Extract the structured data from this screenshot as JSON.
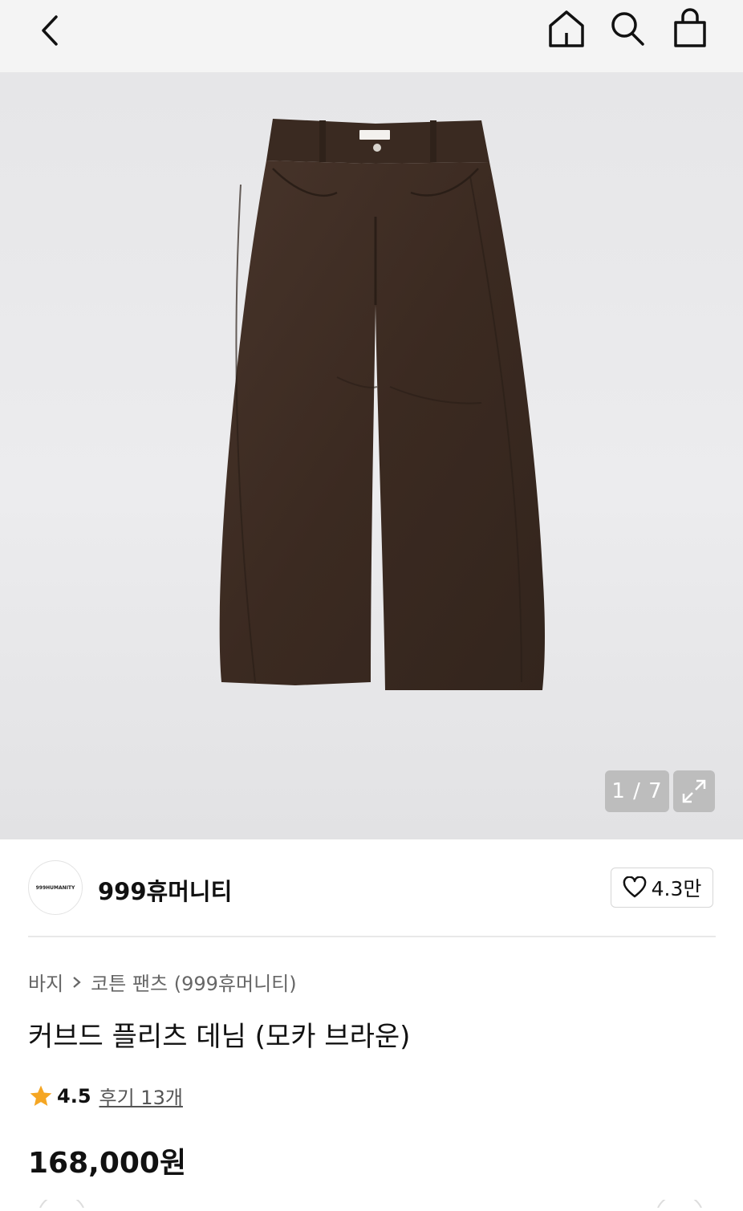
{
  "header": {
    "icons": [
      "chevron-left-icon",
      "home-icon",
      "search-icon",
      "shopping-bag-icon"
    ]
  },
  "gallery": {
    "counter": "1 / 7",
    "colors": {
      "background": "#e8e8ea",
      "product": "#3e2c22"
    }
  },
  "brand": {
    "logo_text": "999HUMANITY",
    "name": "999휴머니티",
    "likes": "4.3만"
  },
  "breadcrumb": {
    "category": "바지",
    "subcategory": "코튼 팬츠 (999휴머니티)"
  },
  "product": {
    "title": "커브드 플리츠 데님 (모카 브라운)",
    "rating": "4.5",
    "reviews": "후기 13개",
    "price": "168,000원",
    "colors": {
      "star": "#f5a623"
    }
  }
}
